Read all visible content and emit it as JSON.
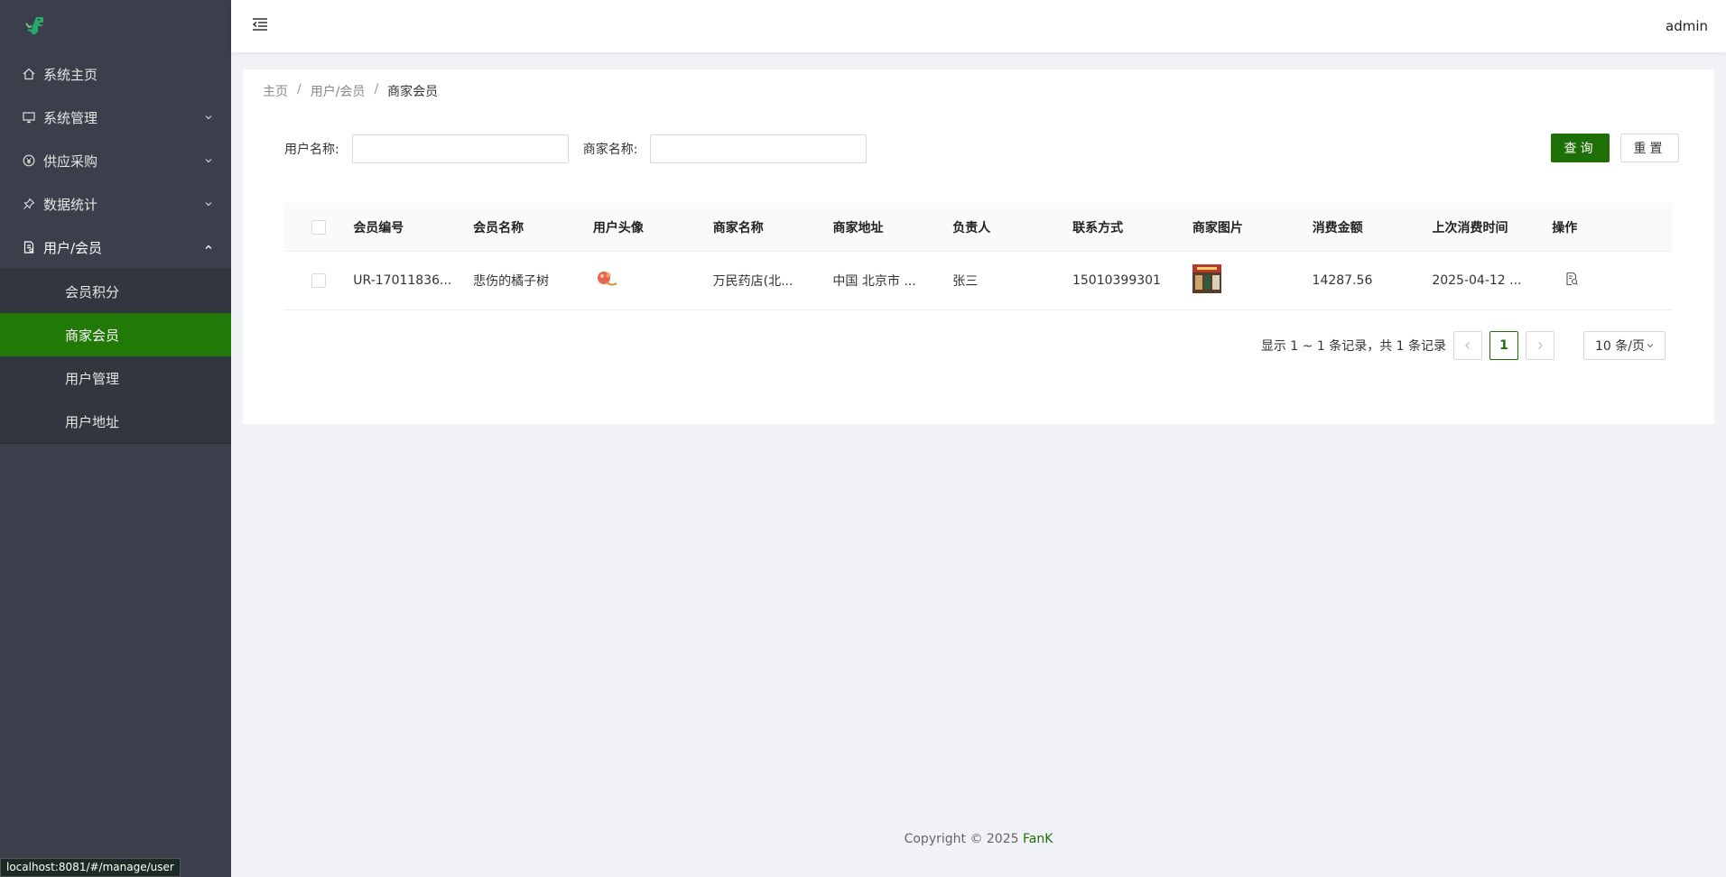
{
  "sidebar": {
    "menu": [
      {
        "label": "系统主页"
      },
      {
        "label": "系统管理"
      },
      {
        "label": "供应采购"
      },
      {
        "label": "数据统计"
      },
      {
        "label": "用户/会员"
      }
    ],
    "submenu": [
      {
        "label": "会员积分"
      },
      {
        "label": "商家会员"
      },
      {
        "label": "用户管理"
      },
      {
        "label": "用户地址"
      }
    ]
  },
  "header": {
    "user": "admin"
  },
  "breadcrumb": {
    "home": "主页",
    "parent": "用户/会员",
    "current": "商家会员"
  },
  "search": {
    "user_label": "用户名称:",
    "user_value": "",
    "merchant_label": "商家名称:",
    "merchant_value": "",
    "query_label": "查询",
    "reset_label": "重置"
  },
  "table": {
    "columns": [
      "会员编号",
      "会员名称",
      "用户头像",
      "商家名称",
      "商家地址",
      "负责人",
      "联系方式",
      "商家图片",
      "消费金额",
      "上次消费时间",
      "操作"
    ],
    "rows": [
      {
        "member_no": "UR-17011836...",
        "member_name": "悲伤的橘子树",
        "merchant_name": "万民药店(北...",
        "merchant_address": "中国 北京市 ...",
        "manager": "张三",
        "contact": "15010399301",
        "amount": "14287.56",
        "last_time": "2025-04-12 ..."
      }
    ]
  },
  "pagination": {
    "summary": "显示 1 ~ 1 条记录，共 1 条记录",
    "current_page": "1",
    "page_size": "10 条/页"
  },
  "footer": {
    "prefix": "Copyright © 2025 ",
    "brand": "FanK"
  },
  "status_url": "localhost:8081/#/manage/user",
  "colors": {
    "accent": "#1f6f09",
    "sidebar": "#3a3f4b",
    "active": "#217a08"
  }
}
